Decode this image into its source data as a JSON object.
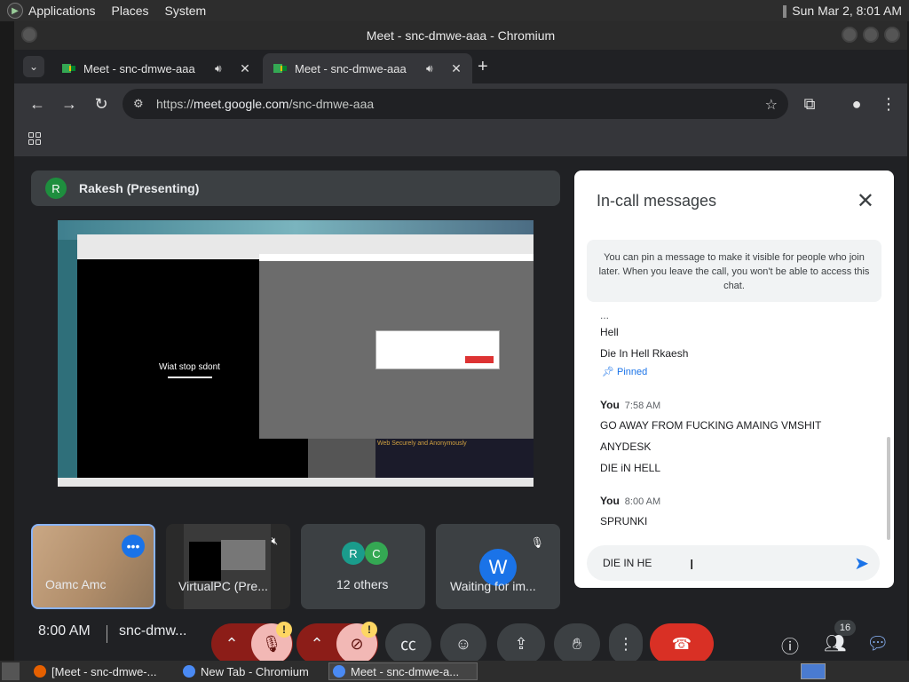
{
  "panel": {
    "menus": [
      "Applications",
      "Places",
      "System"
    ],
    "clock": "Sun Mar  2,  8:01 AM"
  },
  "window": {
    "title": "Meet - snc-dmwe-aaa - Chromium"
  },
  "tabs": [
    {
      "title": "Meet - snc-dmwe-aaa",
      "active": false
    },
    {
      "title": "Meet - snc-dmwe-aaa",
      "active": true
    }
  ],
  "toolbar": {
    "url_scheme": "https://",
    "url_host": "meet.google.com",
    "url_path": "/snc-dmwe-aaa"
  },
  "presenting": {
    "initial": "R",
    "label": "Rakesh (Presenting)"
  },
  "screen_share": {
    "center_text": "Wiat stop sdont",
    "dark_heading": "Web Securely and Anonymously"
  },
  "tiles": [
    {
      "name": "Oamc Amc"
    },
    {
      "name": "VirtualPC (Pre..."
    },
    {
      "name": "12 others",
      "avatars": [
        "R",
        "C"
      ]
    },
    {
      "name": "Waiting for im...",
      "avatar": "W"
    }
  ],
  "chat": {
    "title": "In-call messages",
    "pin_note": "You can pin a message to make it visible for people who join later. When you leave the call, you won't be able to access this chat.",
    "ellipsis": "...",
    "messages_top": [
      "Hell",
      "Die In Hell Rkaesh"
    ],
    "pinned_label": "Pinned",
    "group1": {
      "sender": "You",
      "time": "7:58 AM",
      "lines": [
        "GO AWAY FROM FUCKING AMAING VMSHIT",
        "ANYDESK",
        "DIE iN HELL"
      ]
    },
    "group2": {
      "sender": "You",
      "time": "8:00 AM",
      "lines": [
        "SPRUNKI"
      ]
    },
    "composer_value": "DIE IN HE"
  },
  "bottom": {
    "time": "8:00 AM",
    "meeting_code": "snc-dmw...",
    "people_count": "16"
  },
  "taskbar": {
    "items": [
      "[Meet - snc-dmwe-...",
      "New Tab - Chromium",
      "Meet - snc-dmwe-a..."
    ]
  },
  "colors": {
    "accent": "#1a73e8",
    "end_call": "#d93025",
    "warning": "#fdd663"
  }
}
